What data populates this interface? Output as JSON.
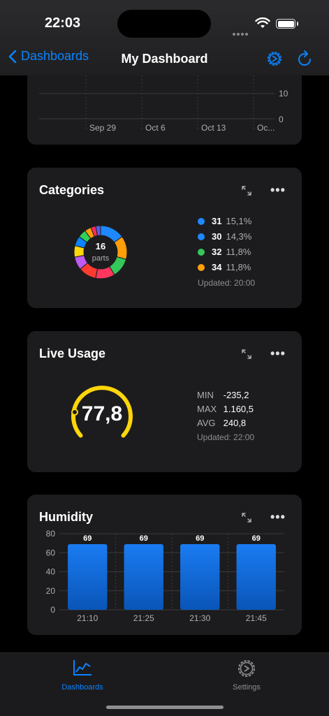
{
  "status_bar": {
    "time": "22:03"
  },
  "nav": {
    "back_label": "Dashboards",
    "title": "My Dashboard"
  },
  "partial_chart": {
    "y_ticks": [
      "10",
      "0"
    ],
    "x_ticks": [
      "Sep 29",
      "Oct 6",
      "Oct 13",
      "Oc..."
    ]
  },
  "categories": {
    "title": "Categories",
    "center_value": "16",
    "center_label": "parts",
    "legend": [
      {
        "value": "31",
        "percent": "15,1%",
        "color": "#1e88ff"
      },
      {
        "value": "30",
        "percent": "14,3%",
        "color": "#1e88ff"
      },
      {
        "value": "32",
        "percent": "11,8%",
        "color": "#34c759"
      },
      {
        "value": "34",
        "percent": "11,8%",
        "color": "#ff9f0a"
      }
    ],
    "updated": "Updated: 20:00",
    "donut_colors": [
      "#1e88ff",
      "#ff9f0a",
      "#34c759",
      "#ff375f",
      "#ff3b30",
      "#bf5af2",
      "#ffd60a",
      "#0a84ff",
      "#30d158",
      "#ff9f0a",
      "#ff2d55",
      "#5e5ce6"
    ]
  },
  "live_usage": {
    "title": "Live Usage",
    "gauge_value": "77,8",
    "gauge_color": "#ffd60a",
    "stats": [
      {
        "label": "MIN",
        "value": "-235,2"
      },
      {
        "label": "MAX",
        "value": "1.160,5"
      },
      {
        "label": "AVG",
        "value": "240,8"
      }
    ],
    "updated": "Updated: 22:00"
  },
  "humidity": {
    "title": "Humidity"
  },
  "chart_data": {
    "type": "bar",
    "title": "Humidity",
    "categories": [
      "21:10",
      "21:25",
      "21:30",
      "21:45"
    ],
    "values": [
      69,
      69,
      69,
      69
    ],
    "data_labels": [
      "69",
      "69",
      "69",
      "69"
    ],
    "ylim": [
      0,
      80
    ],
    "y_ticks": [
      0,
      20,
      40,
      60,
      80
    ],
    "xlabel": "",
    "ylabel": "",
    "grid": true,
    "bar_color": "#1a7cf2"
  },
  "tabbar": {
    "tabs": [
      {
        "label": "Dashboards",
        "active": true
      },
      {
        "label": "Settings",
        "active": false
      }
    ]
  }
}
